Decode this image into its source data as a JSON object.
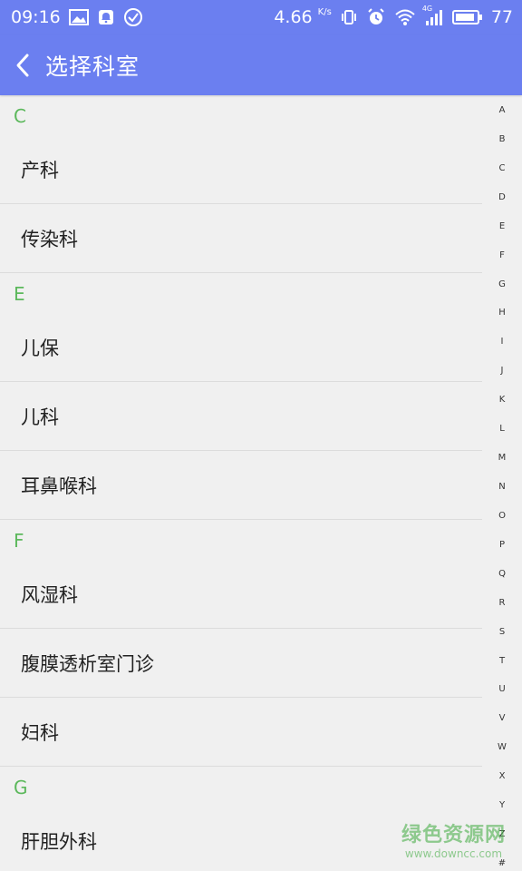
{
  "status": {
    "time": "09:16",
    "speed": "4.66",
    "speed_unit": "K/s",
    "network": "4G",
    "battery": "77"
  },
  "appbar": {
    "title": "选择科室"
  },
  "sections": [
    {
      "letter": "C",
      "items": [
        "产科",
        "传染科"
      ]
    },
    {
      "letter": "E",
      "items": [
        "儿保",
        "儿科",
        "耳鼻喉科"
      ]
    },
    {
      "letter": "F",
      "items": [
        "风湿科",
        "腹膜透析室门诊",
        "妇科"
      ]
    },
    {
      "letter": "G",
      "items": [
        "肝胆外科"
      ]
    }
  ],
  "index_letters": [
    "A",
    "B",
    "C",
    "D",
    "E",
    "F",
    "G",
    "H",
    "I",
    "J",
    "K",
    "L",
    "M",
    "N",
    "O",
    "P",
    "Q",
    "R",
    "S",
    "T",
    "U",
    "V",
    "W",
    "X",
    "Y",
    "Z",
    "#"
  ],
  "watermark": {
    "brand": "绿色资源网",
    "url": "www.downcc.com"
  },
  "colors": {
    "primary": "#6b7ff0",
    "section": "#5cb85c"
  }
}
